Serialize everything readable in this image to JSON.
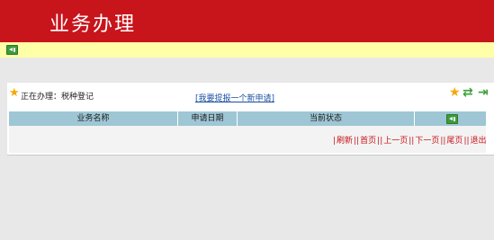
{
  "header": {
    "title": "业务办理"
  },
  "toolbar": {
    "current_label": "正在办理：税种登记",
    "new_application_link": "[我要提报一个新申请]"
  },
  "table": {
    "columns": [
      "业务名称",
      "申请日期",
      "当前状态"
    ]
  },
  "pager": {
    "refresh": "刷新",
    "first": "首页",
    "prev": "上一页",
    "next": "下一页",
    "last": "尾页",
    "exit": "退出"
  },
  "icons": [
    "speaker-icon",
    "star-icon",
    "favorite-icon",
    "refresh-icon",
    "exit-icon"
  ],
  "colors": {
    "brand_red": "#c8141b",
    "notice_yellow": "#ffffa8",
    "table_header": "#9ec6d4",
    "link_blue": "#1a4fa0"
  }
}
